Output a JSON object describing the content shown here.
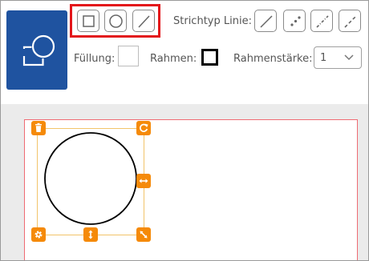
{
  "toolbar": {
    "line_style_label": "Strichtyp Linie:",
    "fill_label": "Füllung:",
    "frame_label": "Rahmen:",
    "frame_width_label": "Rahmenstärke:",
    "frame_width_value": "1",
    "shape_tools": [
      "rectangle-tool",
      "circle-tool",
      "line-tool"
    ],
    "line_styles": [
      "solid",
      "dotted",
      "dash-dot",
      "dashed"
    ]
  },
  "colors": {
    "brand_blue": "#1f53a0",
    "highlight_red": "#e3151a",
    "handle_orange": "#f58a09",
    "selection_outline": "#f2c46a",
    "paper_border": "#ef6b73",
    "workspace_gray": "#ebebeb"
  },
  "icons": {
    "logo": "shape-editor-logo-icon",
    "handles": [
      "trash-icon",
      "rotate-icon",
      "resize-horizontal-icon",
      "settings-icon",
      "resize-vertical-icon",
      "resize-diagonal-icon"
    ]
  }
}
